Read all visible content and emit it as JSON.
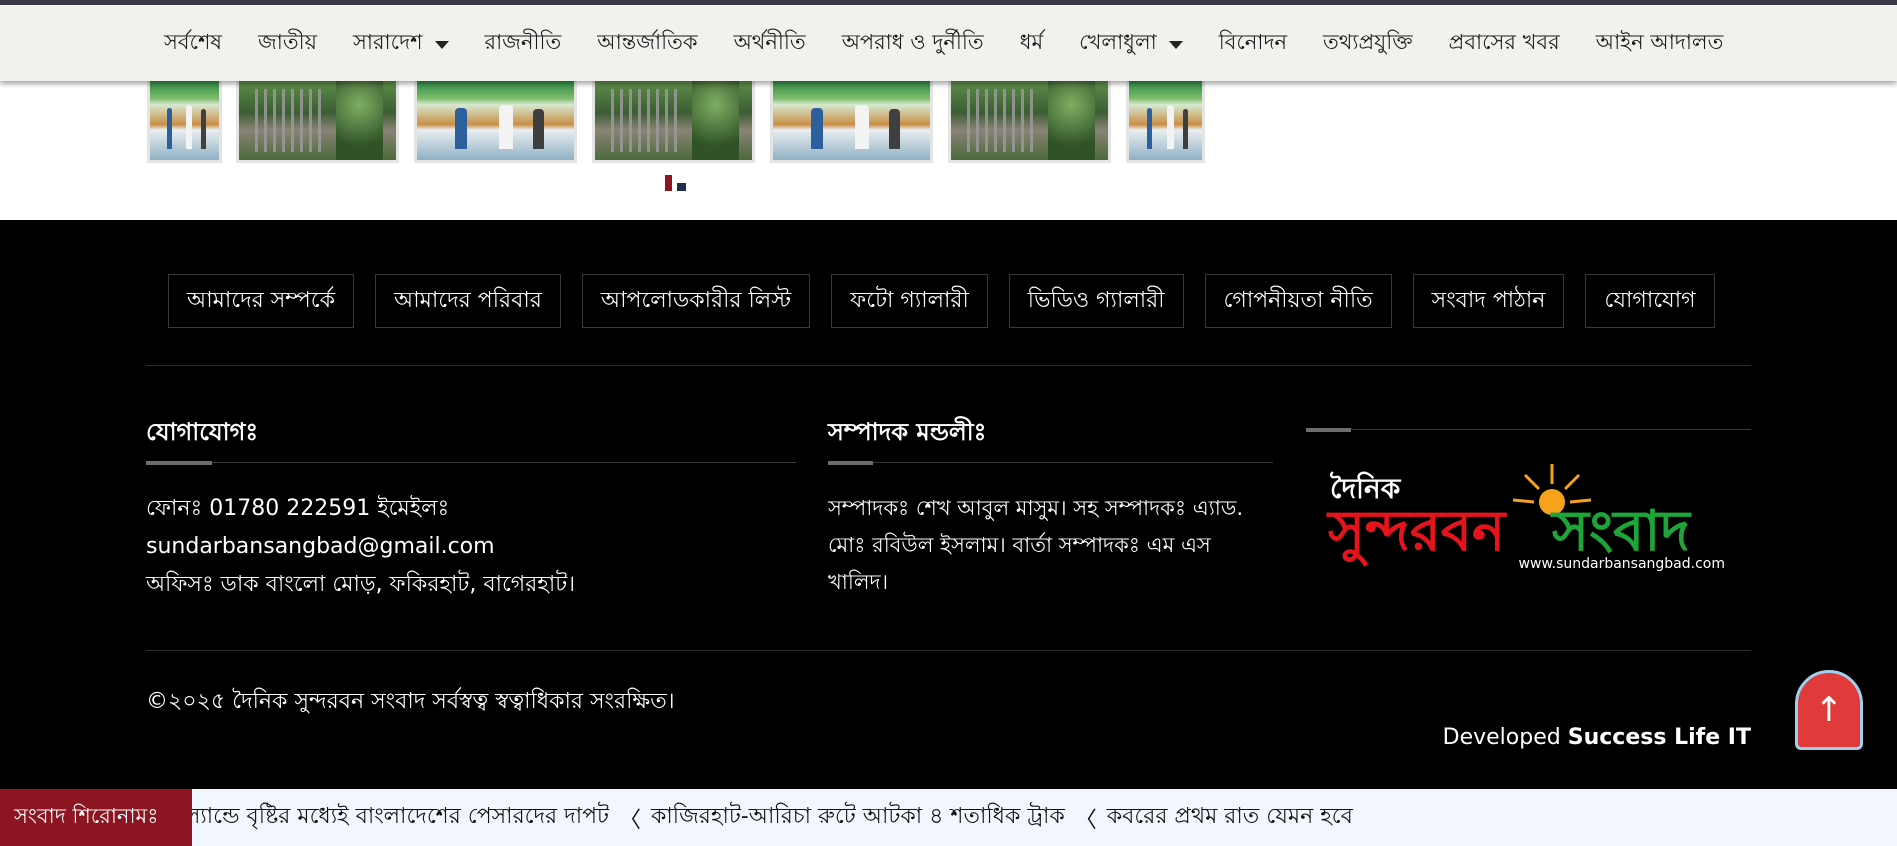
{
  "nav": {
    "items": [
      {
        "label": "সর্বশেষ",
        "has_dropdown": false
      },
      {
        "label": "জাতীয়",
        "has_dropdown": false
      },
      {
        "label": "সারাদেশ",
        "has_dropdown": true
      },
      {
        "label": "রাজনীতি",
        "has_dropdown": false
      },
      {
        "label": "আন্তর্জাতিক",
        "has_dropdown": false
      },
      {
        "label": "অর্থনীতি",
        "has_dropdown": false
      },
      {
        "label": "অপরাধ ও দুর্নীতি",
        "has_dropdown": false
      },
      {
        "label": "ধর্ম",
        "has_dropdown": false
      },
      {
        "label": "খেলাধুলা",
        "has_dropdown": true
      },
      {
        "label": "বিনোদন",
        "has_dropdown": false
      },
      {
        "label": "তথ্যপ্রযুক্তি",
        "has_dropdown": false
      },
      {
        "label": "প্রবাসের খবর",
        "has_dropdown": false
      },
      {
        "label": "আইন আদালত",
        "has_dropdown": false
      }
    ]
  },
  "footer_menu": {
    "items": [
      "আমাদের সম্পর্কে",
      "আমাদের পরিবার",
      "আপলোডকারীর লিস্ট",
      "ফটো গ্যালারী",
      "ভিডিও গ্যালারী",
      "গোপনীয়তা নীতি",
      "সংবাদ পাঠান",
      "যোগাযোগ"
    ]
  },
  "contact": {
    "title": "যোগাযোগঃ",
    "line1": "ফোনঃ 01780 222591 ইমেইলঃ sundarbansangbad@gmail.com",
    "line2": "অফিসঃ ডাক বাংলো মোড়, ফকিরহাট, বাগেরহাট।"
  },
  "editors": {
    "title": "সম্পাদক মন্ডলীঃ",
    "text": "সম্পাদকঃ শেখ আবুল মাসুম। সহ সম্পাদকঃ এ্যাড. মোঃ রবিউল ইসলাম। বার্তা সম্পাদকঃ এম এস খালিদ।"
  },
  "logo": {
    "small": "দৈনিক",
    "part1": "সুন্দরবন",
    "part2": "সংবাদ",
    "url": "www.sundarbansangbad.com",
    "colors": {
      "red": "#e3141b",
      "green": "#1ea53a",
      "sun": "#f6a21b"
    }
  },
  "copyright": "©২০২৫ দৈনিক সুন্দরবন সংবাদ সর্বস্বত্ব স্বত্বাধিকার সংরক্ষিত।",
  "developed": {
    "prefix": "Developed",
    "company": "Success Life IT"
  },
  "scroll_top_icon": "arrow-up-icon",
  "ticker": {
    "label": "সংবাদ শিরোনামঃ",
    "items": [
      "ল্যান্ডে বৃষ্টির মধ্যেই বাংলাদেশের পেসারদের দাপট",
      "কাজিরহাট-আরিচা রুটে আটকা ৪ শতাধিক ট্রাক",
      "কবরের প্রথম রাত যেমন হবে"
    ]
  },
  "colors": {
    "nav_bg": "#f1f1ee",
    "footer_bg": "#000000",
    "accent_red": "#8b1520",
    "to_top": "#e03a3a"
  }
}
